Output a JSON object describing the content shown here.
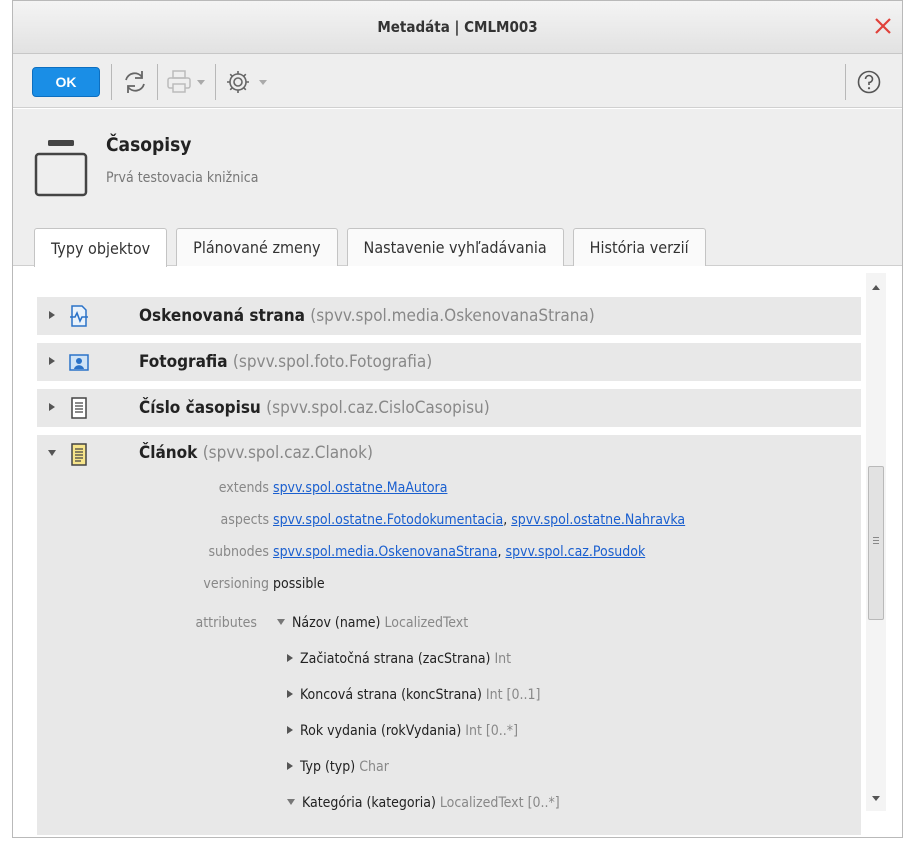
{
  "window": {
    "title": "Metadáta | CMLM003"
  },
  "toolbar": {
    "ok_label": "OK"
  },
  "header": {
    "title": "Časopisy",
    "subtitle": "Prvá testovacia knižnica"
  },
  "tabs": [
    {
      "label": "Typy objektov"
    },
    {
      "label": "Plánované zmeny"
    },
    {
      "label": "Nastavenie vyhľadávania"
    },
    {
      "label": "História verzií"
    }
  ],
  "types": [
    {
      "name": "Oskenovaná strana",
      "tech": "(spvv.spol.media.OskenovanaStrana)"
    },
    {
      "name": "Fotografia",
      "tech": "(spvv.spol.foto.Fotografia)"
    },
    {
      "name": "Číslo časopisu",
      "tech": "(spvv.spol.caz.CisloCasopisu)"
    }
  ],
  "expanded": {
    "name": "Článok",
    "tech": "(spvv.spol.caz.Clanok)",
    "props": {
      "extends_label": "extends",
      "extends_link": "spvv.spol.ostatne.MaAutora",
      "aspects_label": "aspects",
      "aspects_link1": "spvv.spol.ostatne.Fotodokumentacia",
      "aspects_sep": ",",
      "aspects_link2": "spvv.spol.ostatne.Nahravka",
      "subnodes_label": "subnodes",
      "subnodes_link1": "spvv.spol.media.OskenovanaStrana",
      "subnodes_sep": ",",
      "subnodes_link2": "spvv.spol.caz.Posudok",
      "versioning_label": "versioning",
      "versioning_value": "possible",
      "attributes_label": "attributes"
    },
    "attributes": [
      {
        "name": "Názov (name)",
        "type": "LocalizedText"
      },
      {
        "name": "Začiatočná strana (zacStrana)",
        "type": "Int"
      },
      {
        "name": "Koncová strana (koncStrana)",
        "type": "Int [0..1]"
      },
      {
        "name": "Rok vydania (rokVydania)",
        "type": "Int [0..*]"
      },
      {
        "name": "Typ (typ)",
        "type": "Char"
      },
      {
        "name": "Kategória (kategoria)",
        "type": "LocalizedText [0..*]"
      }
    ]
  },
  "colors": {
    "accent": "#1a8ee6",
    "link": "#1a5fcf",
    "close": "#e0413a"
  }
}
